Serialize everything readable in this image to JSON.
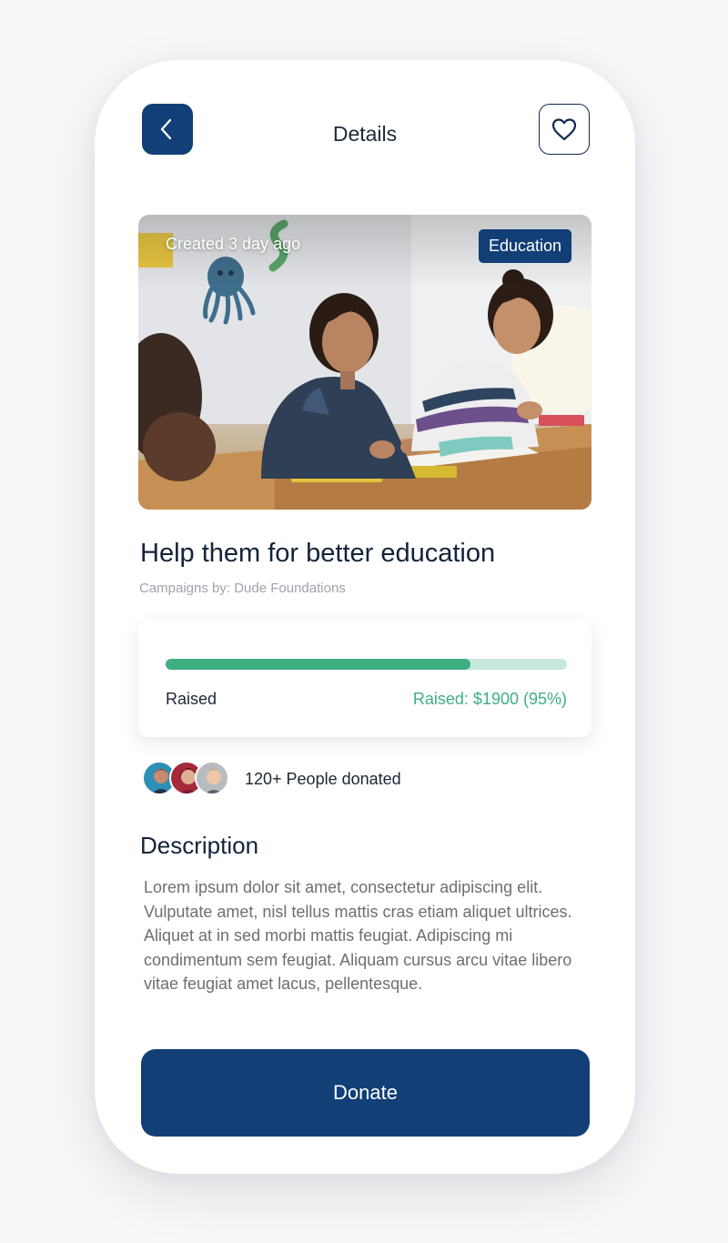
{
  "header": {
    "title": "Details",
    "back_icon": "chevron-left-icon",
    "favorite_icon": "heart-icon"
  },
  "campaign": {
    "created": "Created 3 day ago",
    "category": "Education",
    "title": "Help them for better education",
    "organizer": "Campaigns by: Dude Foundations"
  },
  "progress": {
    "label": "Raised",
    "value_text": "Raised: $1900 (95%)",
    "fill_fraction": 0.76
  },
  "donors": {
    "text": "120+ People donated"
  },
  "description": {
    "heading": "Description",
    "body": "Lorem ipsum dolor sit amet, consectetur adipiscing elit. Vulputate amet, nisl tellus mattis cras etiam aliquet ultrices. Aliquet at in sed morbi mattis feugiat. Adipiscing mi condimentum sem feugiat. Aliquam cursus arcu vitae libero vitae feugiat amet lacus, pellentesque."
  },
  "actions": {
    "donate": "Donate"
  },
  "colors": {
    "primary": "#113f76",
    "accent_green": "#3eaf82",
    "track": "#c5e8da"
  }
}
